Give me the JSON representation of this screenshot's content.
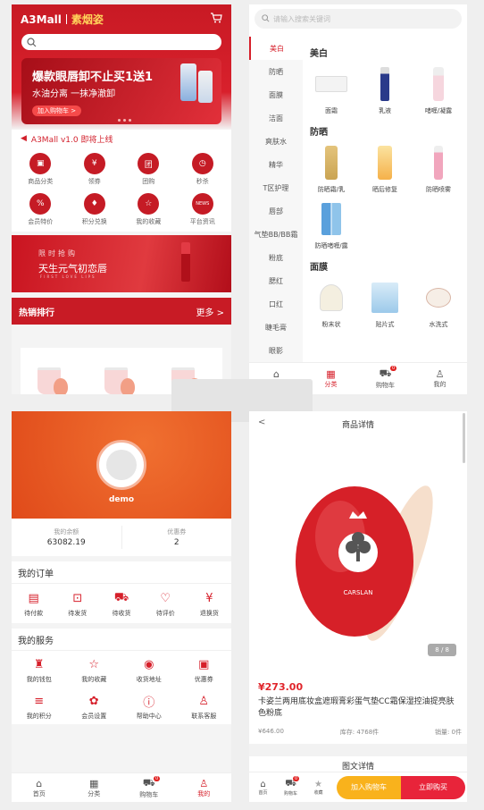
{
  "home": {
    "logo": "A3Mall",
    "subtitle": "素烟姿",
    "banner": {
      "title": "爆款眼唇卸不止买1送1",
      "line2": "水油分离 一抹净澈卸",
      "button": "加入购物车 >"
    },
    "notice": "A3Mall v1.0 即将上线",
    "grid": [
      {
        "label": "商品分类",
        "icon": "bag-icon",
        "glyph": "▣"
      },
      {
        "label": "领券",
        "icon": "coupon-icon",
        "glyph": "¥"
      },
      {
        "label": "团购",
        "icon": "group-icon",
        "glyph": "团"
      },
      {
        "label": "秒杀",
        "icon": "clock-icon",
        "glyph": "◷"
      },
      {
        "label": "会员特价",
        "icon": "discount-icon",
        "glyph": "%"
      },
      {
        "label": "积分兑换",
        "icon": "gift-icon",
        "glyph": "♦"
      },
      {
        "label": "我的收藏",
        "icon": "star-icon",
        "glyph": "☆"
      },
      {
        "label": "平台资讯",
        "icon": "news-icon",
        "glyph": "NEWS"
      }
    ],
    "ad": {
      "line1": "限时抢购",
      "line2": "天生元气初恋唇",
      "line3": "FIRST LOVE LIPS"
    },
    "hot": {
      "title": "热销排行",
      "more": "更多 >"
    }
  },
  "category": {
    "search_placeholder": "请输入搜索关键词",
    "sidebar": [
      "美白",
      "防晒",
      "面膜",
      "洁面",
      "爽肤水",
      "精华",
      "T区护理",
      "唇部",
      "气垫BB/BB霜",
      "粉底",
      "腮红",
      "口红",
      "睫毛膏",
      "眼影"
    ],
    "sections": [
      {
        "title": "美白",
        "items": [
          "面霜",
          "乳液",
          "啫喱/凝露"
        ]
      },
      {
        "title": "防晒",
        "items": [
          "防晒霜/乳",
          "晒后修复",
          "防晒喷雾",
          "防晒啫喱/露"
        ]
      },
      {
        "title": "面膜",
        "items": [
          "粉末状",
          "贴片式",
          "水洗式"
        ]
      }
    ],
    "tabs": [
      {
        "label": "首页",
        "glyph": "⌂"
      },
      {
        "label": "分类",
        "glyph": "▦"
      },
      {
        "label": "购物车",
        "glyph": "⛟"
      },
      {
        "label": "我的",
        "glyph": "♙"
      }
    ],
    "cart_badge": "0"
  },
  "profile": {
    "username": "demo",
    "balance_label": "我的余额",
    "balance": "63082.19",
    "coupon_label": "优惠券",
    "coupons": "2",
    "orders_title": "我的订单",
    "orders": [
      {
        "label": "待付款",
        "glyph": "▤"
      },
      {
        "label": "待发货",
        "glyph": "⊡"
      },
      {
        "label": "待收货",
        "glyph": "⛟"
      },
      {
        "label": "待评价",
        "glyph": "♡"
      },
      {
        "label": "退换货",
        "glyph": "¥"
      }
    ],
    "service_title": "我的服务",
    "services": [
      {
        "label": "我的钱包",
        "glyph": "♜"
      },
      {
        "label": "我的收藏",
        "glyph": "☆"
      },
      {
        "label": "收货地址",
        "glyph": "◉"
      },
      {
        "label": "优惠券",
        "glyph": "▣"
      },
      {
        "label": "我的积分",
        "glyph": "≡"
      },
      {
        "label": "会员设置",
        "glyph": "✿"
      },
      {
        "label": "帮助中心",
        "glyph": "ⓘ"
      },
      {
        "label": "联系客服",
        "glyph": "♙"
      }
    ],
    "tabs": [
      {
        "label": "首页",
        "glyph": "⌂"
      },
      {
        "label": "分类",
        "glyph": "▦"
      },
      {
        "label": "购物车",
        "glyph": "⛟"
      },
      {
        "label": "我的",
        "glyph": "♙"
      }
    ],
    "cart_badge": "0"
  },
  "detail": {
    "title": "商品详情",
    "back": "<",
    "pager": "8 / 8",
    "price": "¥273.00",
    "name": "卡姿兰两用底妆盒遮瑕膏彩蛋气垫CC霜保湿控油提亮肤色粉底",
    "market_price": "¥646.00",
    "stock": "库存: 4768件",
    "sales": "销量: 0件",
    "section": "图文详情",
    "brand_text": "CARSLAN",
    "bar": {
      "home": "首页",
      "cart": "购物车",
      "fav": "收藏",
      "add_cart": "加入购物车",
      "buy": "立即购买",
      "cart_badge": "0"
    }
  },
  "colors": {
    "accent": "#d61f2a",
    "orange": "#e8581f"
  }
}
